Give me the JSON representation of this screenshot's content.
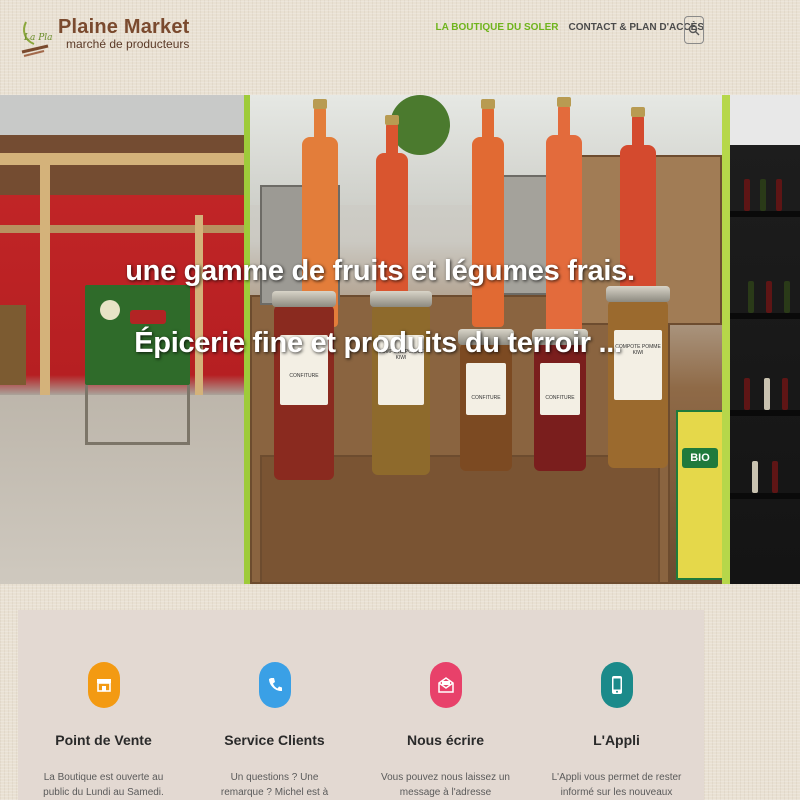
{
  "brand": {
    "script_mark": "La Plaine",
    "title": "Plaine Market",
    "subtitle": "marché de producteurs"
  },
  "nav": {
    "items": [
      {
        "label": "LA BOUTIQUE DU SOLER",
        "active": true
      },
      {
        "label": "CONTACT & PLAN D'ACCÈS",
        "active": false
      }
    ],
    "search_icon": "search-icon"
  },
  "hero": {
    "line1": "une gamme de fruits et légumes frais.",
    "line2": "Épicerie fine et produits du terroir ...",
    "jar_labels": [
      "CONFITURE",
      "COMPOTE POMME KIWI",
      "CONFITURE",
      "CONFITURE",
      "COMPOTE POMME KIWI"
    ],
    "box_label": "BIO"
  },
  "services": [
    {
      "title": "Point de Vente",
      "icon": "store-icon",
      "color": "#f39a12",
      "text": "La Boutique est ouverte au public du Lundi au Samedi. RDV à l'entrée de la"
    },
    {
      "title": "Service Clients",
      "icon": "phone-icon",
      "color": "#3aa0e6",
      "text": "Un questions ? Une remarque ? Michel est à votre écoute du Lundi au"
    },
    {
      "title": "Nous écrire",
      "icon": "envelope-icon",
      "color": "#e8416a",
      "text": "Vous pouvez nous laissez un message à l'adresse suivante contact@plaine-"
    },
    {
      "title": "L'Appli",
      "icon": "smartphone-icon",
      "color": "#1b8a8a",
      "text": "L'Appli vous permet de rester informé sur les nouveaux produits en vente et"
    }
  ],
  "colors": {
    "accent_green": "#6fb41c",
    "background": "#e9e1d3",
    "card_background": "#e3d9d2"
  }
}
